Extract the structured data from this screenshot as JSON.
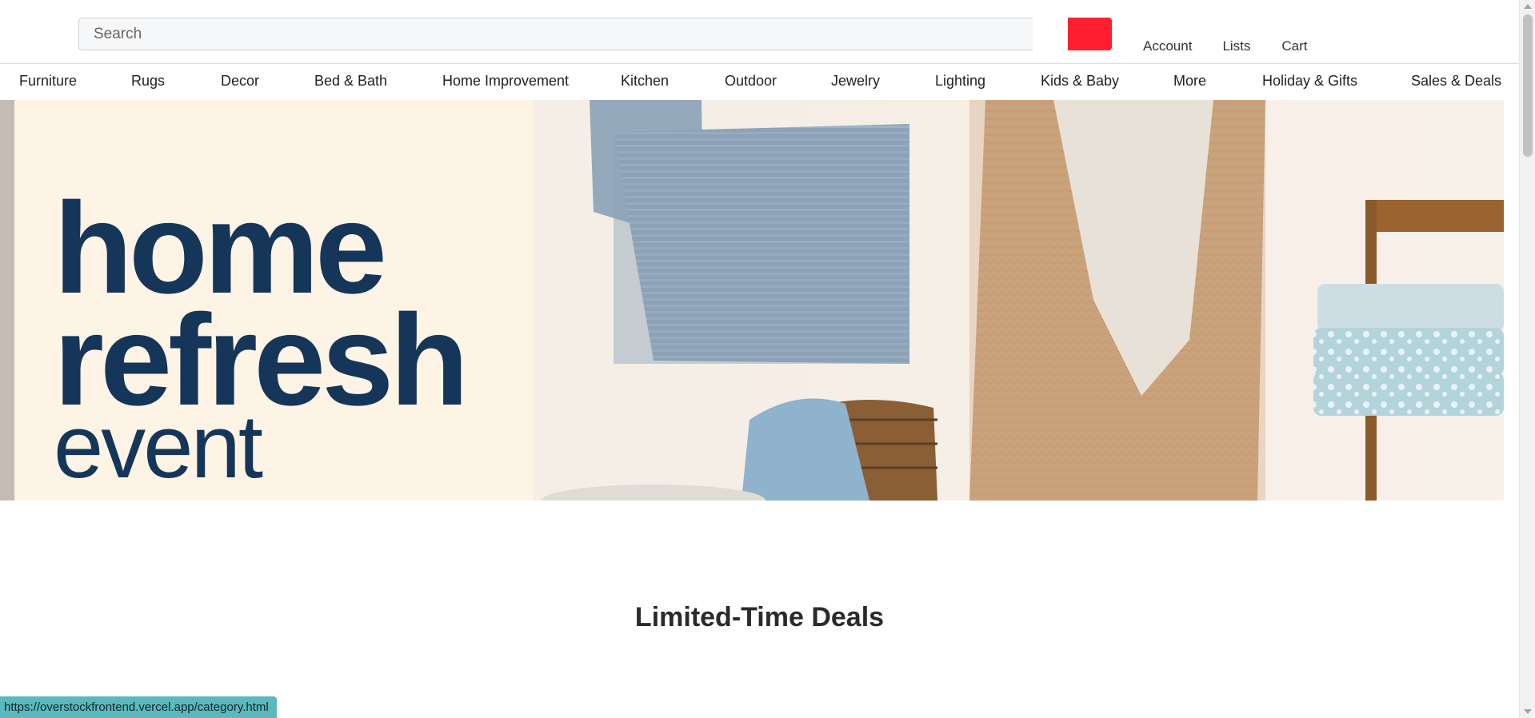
{
  "search": {
    "placeholder": "Search"
  },
  "account_links": {
    "account": "Account",
    "lists": "Lists",
    "cart": "Cart"
  },
  "category_nav": [
    "Furniture",
    "Rugs",
    "Decor",
    "Bed & Bath",
    "Home Improvement",
    "Kitchen",
    "Outdoor",
    "Jewelry",
    "Lighting",
    "Kids & Baby",
    "More",
    "Holiday & Gifts",
    "Sales & Deals"
  ],
  "hero": {
    "line1": "home",
    "line2": "refresh",
    "line3": "event"
  },
  "section": {
    "title": "Limited-Time Deals"
  },
  "status_bar": {
    "url": "https://overstockfrontend.vercel.app/category.html"
  },
  "colors": {
    "search_button": "#ff1f2e",
    "hero_text": "#163659",
    "hero_panel": "#fdf4e6",
    "status_bar": "#5bb8bd"
  },
  "icons": {
    "search_button": "search-icon"
  }
}
